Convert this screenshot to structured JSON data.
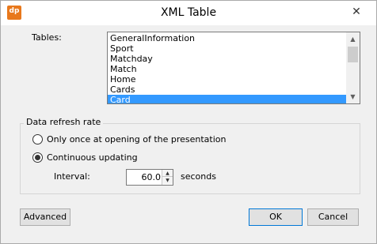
{
  "window": {
    "title": "XML Table",
    "app_icon_text": "dp",
    "close_glyph": "✕"
  },
  "tables": {
    "label": "Tables:",
    "items": [
      "GeneralInformation",
      "Sport",
      "Matchday",
      "Match",
      "Home",
      "Cards",
      "Card"
    ],
    "selected": "Card"
  },
  "refresh": {
    "group_label": "Data refresh rate",
    "options": [
      {
        "label": "Only once at opening of the presentation",
        "checked": false
      },
      {
        "label": "Continuous updating",
        "checked": true
      }
    ],
    "interval_label": "Interval:",
    "interval_value": "60.0",
    "interval_unit": "seconds"
  },
  "buttons": {
    "advanced": "Advanced",
    "ok": "OK",
    "cancel": "Cancel"
  },
  "colors": {
    "selection": "#3399ff",
    "app_icon": "#e8781c",
    "default_button_border": "#0078d7"
  }
}
